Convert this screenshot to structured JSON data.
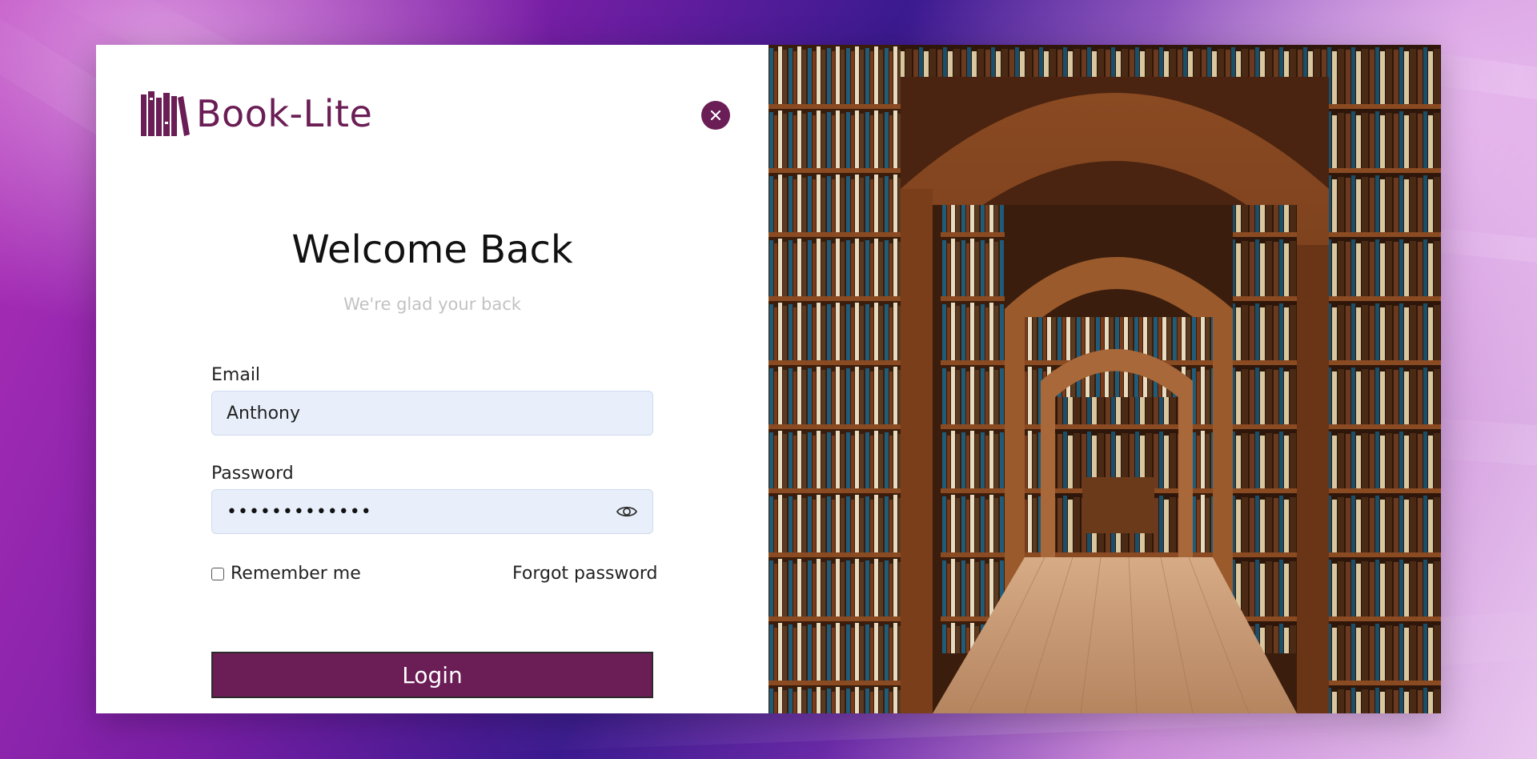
{
  "app": {
    "brand": "Book-Lite",
    "accent_color": "#6b1d55"
  },
  "login": {
    "title": "Welcome Back",
    "subtitle": "We're glad your back",
    "email_label": "Email",
    "email_value": "Anthony",
    "password_label": "Password",
    "password_masked": "•••••••••••••",
    "remember_label": "Remember me",
    "remember_checked": false,
    "forgot_label": "Forgot password",
    "login_label": "Login"
  },
  "icons": {
    "logo": "books-logo-icon",
    "close": "close-icon",
    "show_password": "eye-icon"
  }
}
